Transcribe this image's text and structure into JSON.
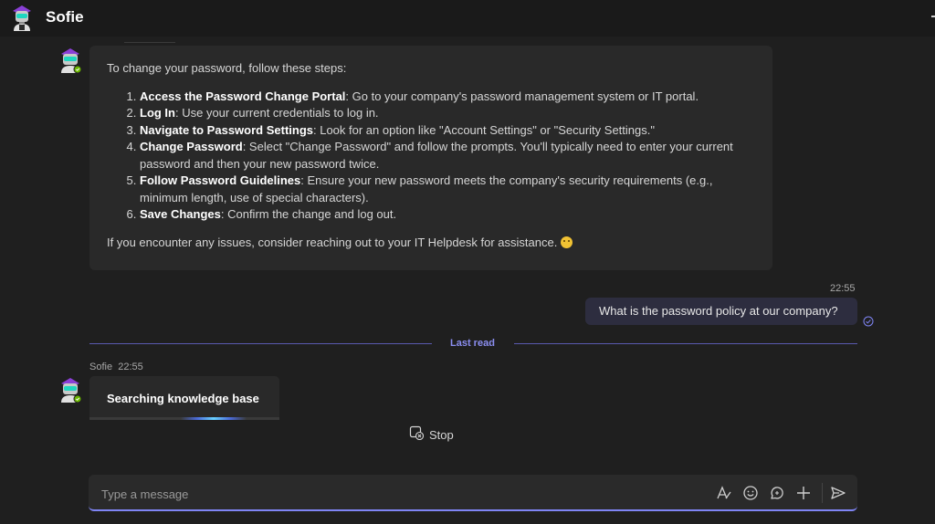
{
  "header": {
    "title": "Sofie"
  },
  "messages": {
    "bot_intro": "To change your password, follow these steps:",
    "steps": [
      {
        "bold": "Access the Password Change Portal",
        "text": ": Go to your company's password management system or IT portal."
      },
      {
        "bold": "Log In",
        "text": ": Use your current credentials to log in."
      },
      {
        "bold": "Navigate to Password Settings",
        "text": ": Look for an option like \"Account Settings\" or \"Security Settings.\""
      },
      {
        "bold": "Change Password",
        "text": ": Select \"Change Password\" and follow the prompts. You'll typically need to enter your current password and then your new password twice."
      },
      {
        "bold": "Follow Password Guidelines",
        "text": ": Ensure your new password meets the company's security requirements (e.g., minimum length, use of special characters)."
      },
      {
        "bold": "Save Changes",
        "text": ": Confirm the change and log out."
      }
    ],
    "bot_outro": "If you encounter any issues, consider reaching out to your IT Helpdesk for assistance.",
    "user_time": "22:55",
    "user_text": "What is the password policy at our company?",
    "last_read_label": "Last read",
    "sender_name": "Sofie",
    "sender_time": "22:55",
    "searching_text": "Searching knowledge base",
    "stop_label": "Stop"
  },
  "composer": {
    "placeholder": "Type a message"
  },
  "icons": {
    "avatar": "robot-avatar-icon",
    "presence": "presence-available-icon",
    "read_receipt": "read-receipt-icon",
    "stop": "stop-icon",
    "format": "format-icon",
    "emoji": "emoji-icon",
    "loop": "loop-icon",
    "add": "plus-icon",
    "send": "send-icon"
  },
  "colors": {
    "accent": "#7f85f5",
    "presence": "#6bb700",
    "user_bubble": "#2d2d3f"
  }
}
